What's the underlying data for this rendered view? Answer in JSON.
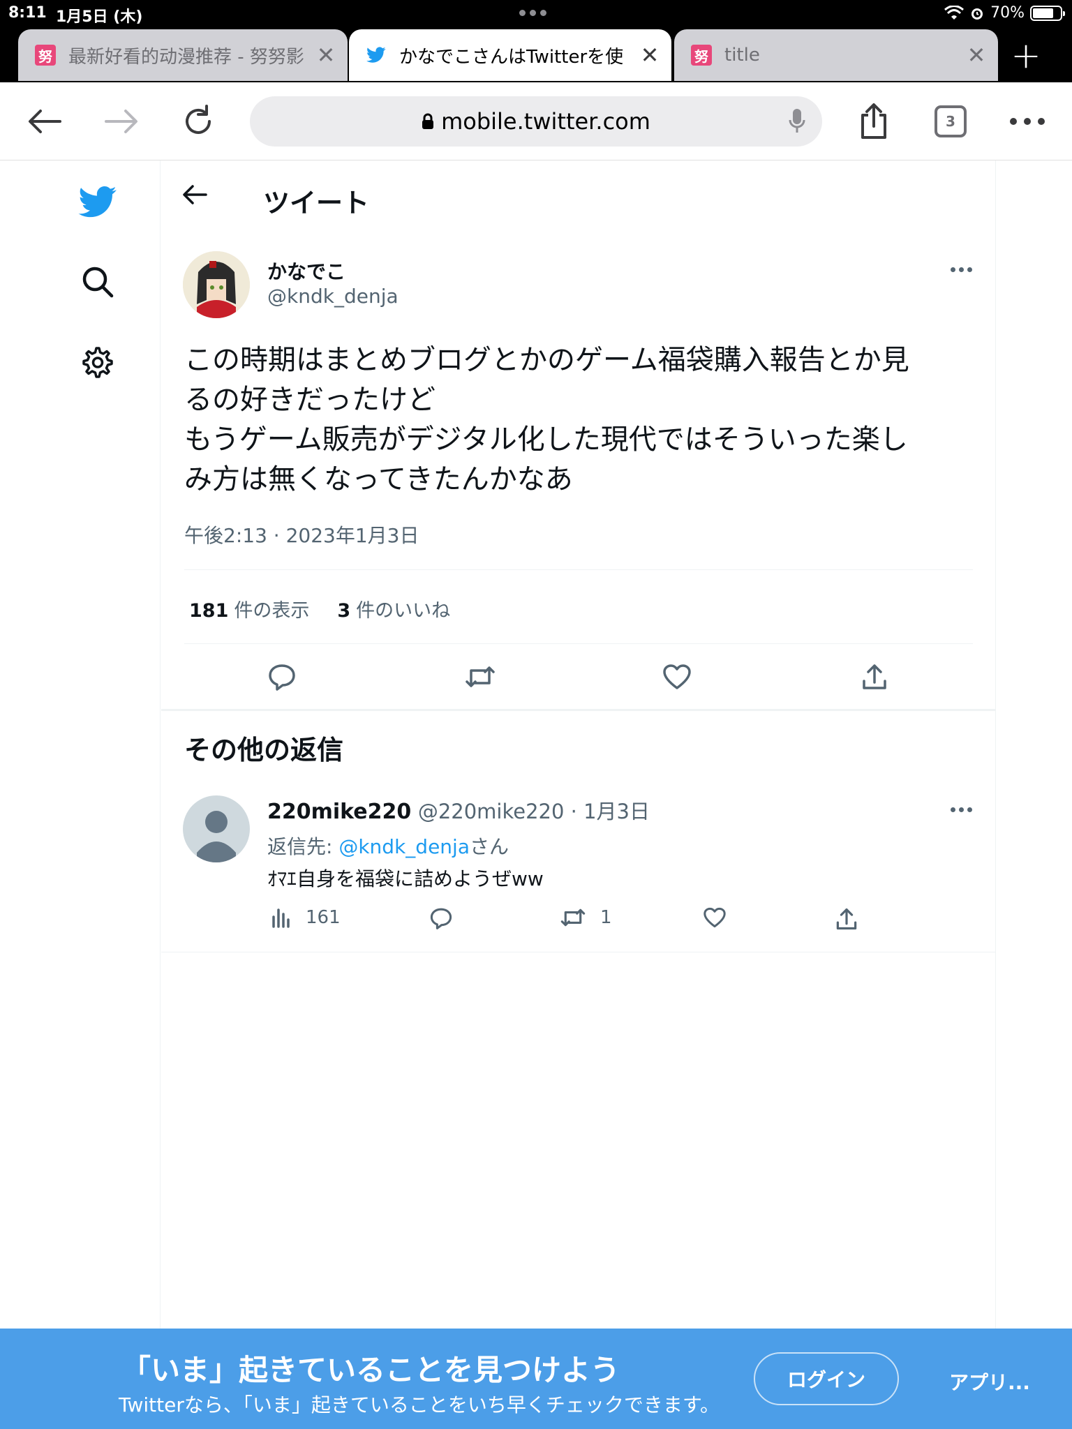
{
  "status_bar": {
    "time": "8:11",
    "date": "1月5日 (木)",
    "battery": "70%"
  },
  "tabs": [
    {
      "title": "最新好看的动漫推荐 - 努努影",
      "favicon": "努",
      "active": false
    },
    {
      "title": "かなでこさんはTwitterを使",
      "favicon": "twitter-bird-icon",
      "active": true
    },
    {
      "title": "title",
      "favicon": "努",
      "active": false
    }
  ],
  "toolbar": {
    "url": "mobile.twitter.com",
    "tab_count": "3"
  },
  "page": {
    "header_title": "ツイート",
    "tweet": {
      "name": "かなでこ",
      "handle": "@kndk_denja",
      "text_lines": [
        "この時期はまとめブログとかのゲーム福袋購入報告とか見",
        "るの好きだったけど",
        "もうゲーム販売がデジタル化した現代ではそういった楽し",
        "み方は無くなってきたんかなあ"
      ],
      "time": "午後2:13 · 2023年1月3日",
      "views_count": "181",
      "views_label": "件の表示",
      "likes_count": "3",
      "likes_label": "件のいいね"
    },
    "section_title": "その他の返信",
    "reply": {
      "name": "220mike220",
      "handle_date": "@220mike220 · 1月3日",
      "reply_to_prefix": "返信先: ",
      "reply_to_link": "@kndk_denja",
      "reply_to_suffix": "さん",
      "text": "ｵﾏｴ自身を福袋に詰めようぜww",
      "views": "161",
      "retweets": "1"
    }
  },
  "banner": {
    "headline": "「いま」起きていることを見つけよう",
    "subtext": "Twitterなら、「いま」起きていることをいち早くチェックできます。",
    "login": "ログイン",
    "app": "アプリ..."
  },
  "colors": {
    "twitter_blue": "#1d9bf0",
    "banner_blue": "#4c9ee8"
  }
}
